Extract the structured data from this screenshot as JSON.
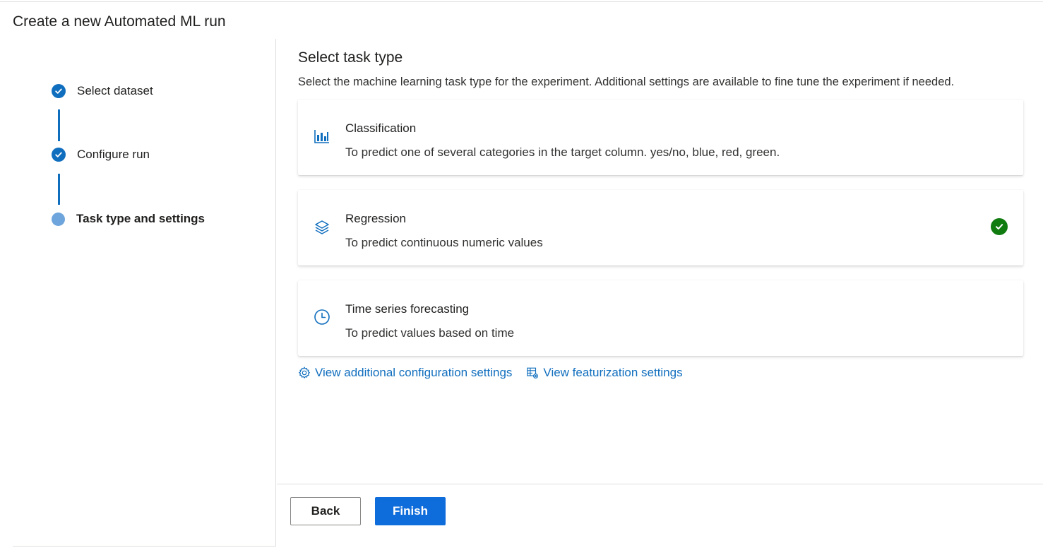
{
  "page": {
    "title": "Create a new Automated ML run"
  },
  "wizard": {
    "steps": [
      {
        "label": "Select dataset",
        "state": "complete"
      },
      {
        "label": "Configure run",
        "state": "complete"
      },
      {
        "label": "Task type and settings",
        "state": "current"
      }
    ]
  },
  "task": {
    "title": "Select task type",
    "description": "Select the machine learning task type for the experiment. Additional settings are available to fine tune the experiment if needed.",
    "options": [
      {
        "title": "Classification",
        "description": "To predict one of several categories in the target column. yes/no, blue, red, green.",
        "icon": "bar-chart-icon",
        "selected": false
      },
      {
        "title": "Regression",
        "description": "To predict continuous numeric values",
        "icon": "layers-icon",
        "selected": true
      },
      {
        "title": "Time series forecasting",
        "description": "To predict values based on time",
        "icon": "clock-icon",
        "selected": false
      }
    ]
  },
  "links": {
    "additional_config": "View additional configuration settings",
    "featurization": "View featurization settings"
  },
  "buttons": {
    "back": "Back",
    "finish": "Finish"
  },
  "colors": {
    "accent": "#106ebe",
    "primary_button": "#0f6cdb",
    "success": "#107c10",
    "step_current": "#6da5dc"
  }
}
